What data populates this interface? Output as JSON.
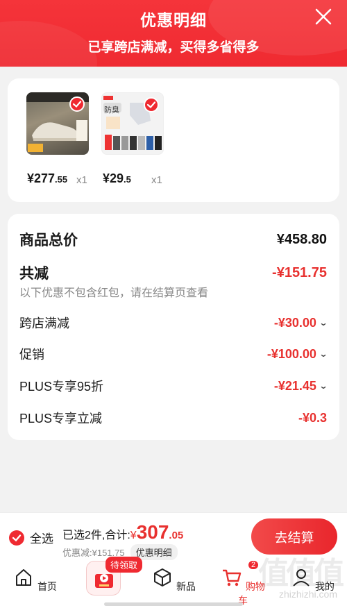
{
  "header": {
    "title": "优惠明细",
    "subtitle": "已享跨店满减，买得多省得多",
    "close_icon": "close-icon"
  },
  "products": [
    {
      "price_int": "¥277",
      "price_dec": ".55",
      "qty": "x1",
      "selected": true
    },
    {
      "price_int": "¥29",
      "price_dec": ".5",
      "qty": "x1",
      "selected": true,
      "tag": "防臭"
    }
  ],
  "summary": {
    "total_label": "商品总价",
    "total_value": "¥458.80",
    "reduce_label": "共减",
    "reduce_value": "-¥151.75",
    "note": "以下优惠不包含红包，请在结算页查看",
    "items": [
      {
        "label": "跨店满减",
        "value": "-¥30.00",
        "expandable": true
      },
      {
        "label": "促销",
        "value": "-¥100.00",
        "expandable": true
      },
      {
        "label": "PLUS专享95折",
        "value": "-¥21.45",
        "expandable": true
      },
      {
        "label": "PLUS专享立减",
        "value": "-¥0.3",
        "expandable": false
      }
    ]
  },
  "bottom_bar": {
    "select_all": "全选",
    "selected_text": "已选2件,合计:",
    "currency": "¥",
    "total_int": "307",
    "total_dec": ".05",
    "discount_text": "优惠减:¥151.75",
    "detail_label": "优惠明细",
    "checkout_label": "去结算"
  },
  "tabbar": {
    "items": [
      {
        "label": "首页",
        "icon": "home-icon"
      },
      {
        "label": "",
        "icon": "coupon-icon",
        "tag": "待领取"
      },
      {
        "label": "新品",
        "icon": "box-icon"
      },
      {
        "label": "购物车",
        "icon": "cart-icon",
        "badge": "2",
        "active": true
      },
      {
        "label": "我的",
        "icon": "user-icon"
      }
    ]
  },
  "watermark": {
    "logo": "值值值",
    "url": "zhizhizhi.com"
  },
  "colors": {
    "accent": "#ef2a31",
    "price_red": "#e8312f"
  }
}
